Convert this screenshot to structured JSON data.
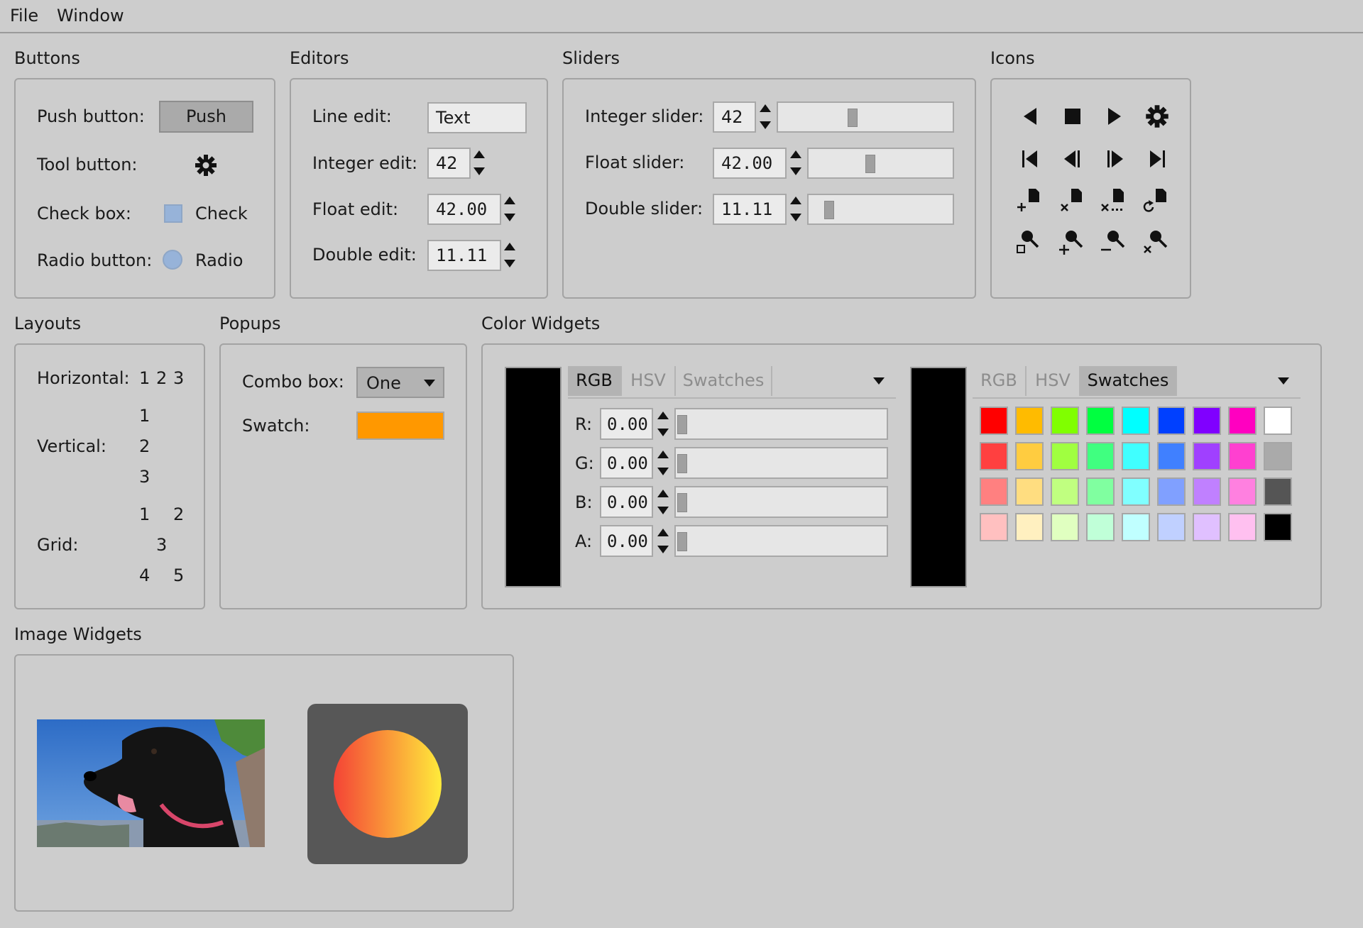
{
  "menubar": {
    "items": [
      "File",
      "Window"
    ]
  },
  "buttons": {
    "title": "Buttons",
    "push_label": "Push button:",
    "push_text": "Push",
    "tool_label": "Tool button:",
    "tool_icon": "gear-icon",
    "check_label": "Check box:",
    "check_text": "Check",
    "check_checked": false,
    "radio_label": "Radio button:",
    "radio_text": "Radio",
    "radio_selected": false
  },
  "editors": {
    "title": "Editors",
    "line_label": "Line edit:",
    "line_value": "Text",
    "int_label": "Integer edit:",
    "int_value": "42",
    "float_label": "Float edit:",
    "float_value": "42.00",
    "double_label": "Double edit:",
    "double_value": "11.11"
  },
  "sliders": {
    "title": "Sliders",
    "int_label": "Integer slider:",
    "int_value": "42",
    "int_fraction": 0.42,
    "float_label": "Float slider:",
    "float_value": "42.00",
    "float_fraction": 0.42,
    "double_label": "Double slider:",
    "double_value": "11.11",
    "double_fraction": 0.11
  },
  "icons": {
    "title": "Icons",
    "names": [
      "back-arrow-icon",
      "stop-icon",
      "play-icon",
      "settings-icon",
      "first-frame-icon",
      "previous-frame-icon",
      "next-frame-icon",
      "last-frame-icon",
      "new-file-icon",
      "close-file-icon",
      "close-all-files-icon",
      "reload-file-icon",
      "zoom-reset-icon",
      "zoom-in-icon",
      "zoom-out-icon",
      "zoom-close-icon"
    ]
  },
  "layouts": {
    "title": "Layouts",
    "horizontal_label": "Horizontal:",
    "horizontal_items": [
      "1",
      "2",
      "3"
    ],
    "vertical_label": "Vertical:",
    "vertical_items": [
      "1",
      "2",
      "3"
    ],
    "grid_label": "Grid:",
    "grid_items": [
      "1",
      "2",
      "3",
      "4",
      "5"
    ]
  },
  "popups": {
    "title": "Popups",
    "combo_label": "Combo box:",
    "combo_value": "One",
    "swatch_label": "Swatch:",
    "swatch_color": "#ff9800"
  },
  "color_widgets": {
    "title": "Color Widgets",
    "left": {
      "tabs": [
        "RGB",
        "HSV",
        "Swatches"
      ],
      "active_tab": "RGB",
      "preview_color": "#000000",
      "channels": [
        {
          "label": "R:",
          "value": "0.00",
          "fraction": 0.0
        },
        {
          "label": "G:",
          "value": "0.00",
          "fraction": 0.0
        },
        {
          "label": "B:",
          "value": "0.00",
          "fraction": 0.0
        },
        {
          "label": "A:",
          "value": "0.00",
          "fraction": 0.0
        }
      ]
    },
    "right": {
      "tabs": [
        "RGB",
        "HSV",
        "Swatches"
      ],
      "active_tab": "Swatches",
      "preview_color": "#000000",
      "swatches": [
        [
          "#ff0000",
          "#ffbb00",
          "#80ff00",
          "#00ff40",
          "#00ffff",
          "#0040ff",
          "#8000ff",
          "#ff00c0",
          "#ffffff"
        ],
        [
          "#ff4040",
          "#ffcc40",
          "#a0ff40",
          "#40ff80",
          "#40ffff",
          "#4080ff",
          "#a040ff",
          "#ff40d0",
          "#aaaaaa"
        ],
        [
          "#ff8080",
          "#ffdd80",
          "#c0ff80",
          "#80ffa0",
          "#80ffff",
          "#80a0ff",
          "#c080ff",
          "#ff80e0",
          "#555555"
        ],
        [
          "#ffc0c0",
          "#fff0c0",
          "#e0ffc0",
          "#c0ffd8",
          "#c0ffff",
          "#c0d0ff",
          "#e0c0ff",
          "#ffc0f0",
          "#000000"
        ]
      ]
    }
  },
  "image_widgets": {
    "title": "Image Widgets",
    "photo_desc": "dog-photo",
    "circle_gradient": [
      "#f44336",
      "#ffeb3b"
    ],
    "circle_bg": "#575757"
  }
}
